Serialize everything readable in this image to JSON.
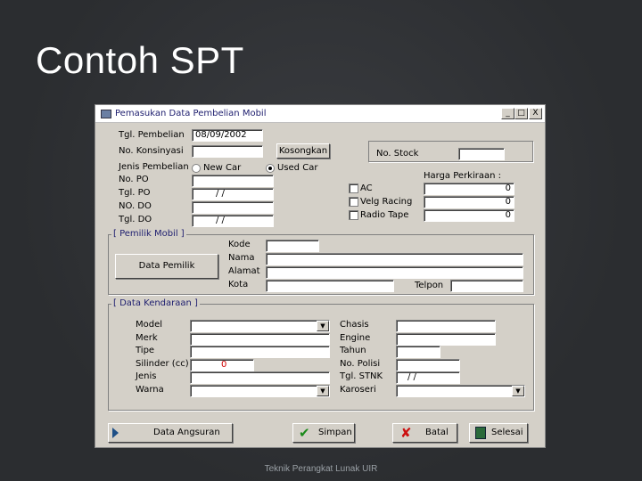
{
  "slide": {
    "title": "Contoh SPT",
    "footer": "Teknik Perangkat Lunak UIR"
  },
  "window": {
    "title": "Pemasukan Data Pembelian Mobil",
    "min_label": "_",
    "max_label": "□",
    "close_label": "X"
  },
  "purchase": {
    "tgl_pembelian_label": "Tgl. Pembelian",
    "tgl_pembelian_value": "08/09/2002",
    "no_konsinyasi_label": "No. Konsinyasi",
    "no_konsinyasi_value": "",
    "kosongkan_label": "Kosongkan",
    "jenis_pembelian_label": "Jenis Pembelian",
    "new_car_label": "New Car",
    "used_car_label": "Used Car",
    "no_po_label": "No. PO",
    "tgl_po_label": "Tgl. PO",
    "tgl_po_value": "/   /",
    "no_do_label": "NO. DO",
    "tgl_do_label": "Tgl. DO",
    "tgl_do_value": "/   /",
    "no_stock_label": "No. Stock",
    "harga_label": "Harga Perkiraan :",
    "ac_label": "AC",
    "ac_value": "0",
    "velg_label": "Velg Racing",
    "velg_value": "0",
    "radio_label": "Radio Tape",
    "radio_value": "0"
  },
  "owner": {
    "group_title": "[ Pemilik Mobil ]",
    "data_pemilik_label": "Data Pemilik",
    "kode_label": "Kode",
    "nama_label": "Nama",
    "alamat_label": "Alamat",
    "kota_label": "Kota",
    "telpon_label": "Telpon"
  },
  "vehicle": {
    "group_title": "[ Data Kendaraan ]",
    "model_label": "Model",
    "merk_label": "Merk",
    "tipe_label": "Tipe",
    "silinder_label": "Silinder (cc)",
    "silinder_value": "0",
    "jenis_label": "Jenis",
    "warna_label": "Warna",
    "chasis_label": "Chasis",
    "engine_label": "Engine",
    "tahun_label": "Tahun",
    "no_polisi_label": "No. Polisi",
    "tgl_stnk_label": "Tgl. STNK",
    "tgl_stnk_value": "/   /",
    "karoseri_label": "Karoseri"
  },
  "actions": {
    "angsuran_label": "Data Angsuran",
    "simpan_label": "Simpan",
    "batal_label": "Batal",
    "selesai_label": "Selesai"
  },
  "colors": {
    "accent": "#000080",
    "window_bg": "#d4d0c8",
    "group_title": "#202070",
    "silinder_red": "#d00000"
  }
}
